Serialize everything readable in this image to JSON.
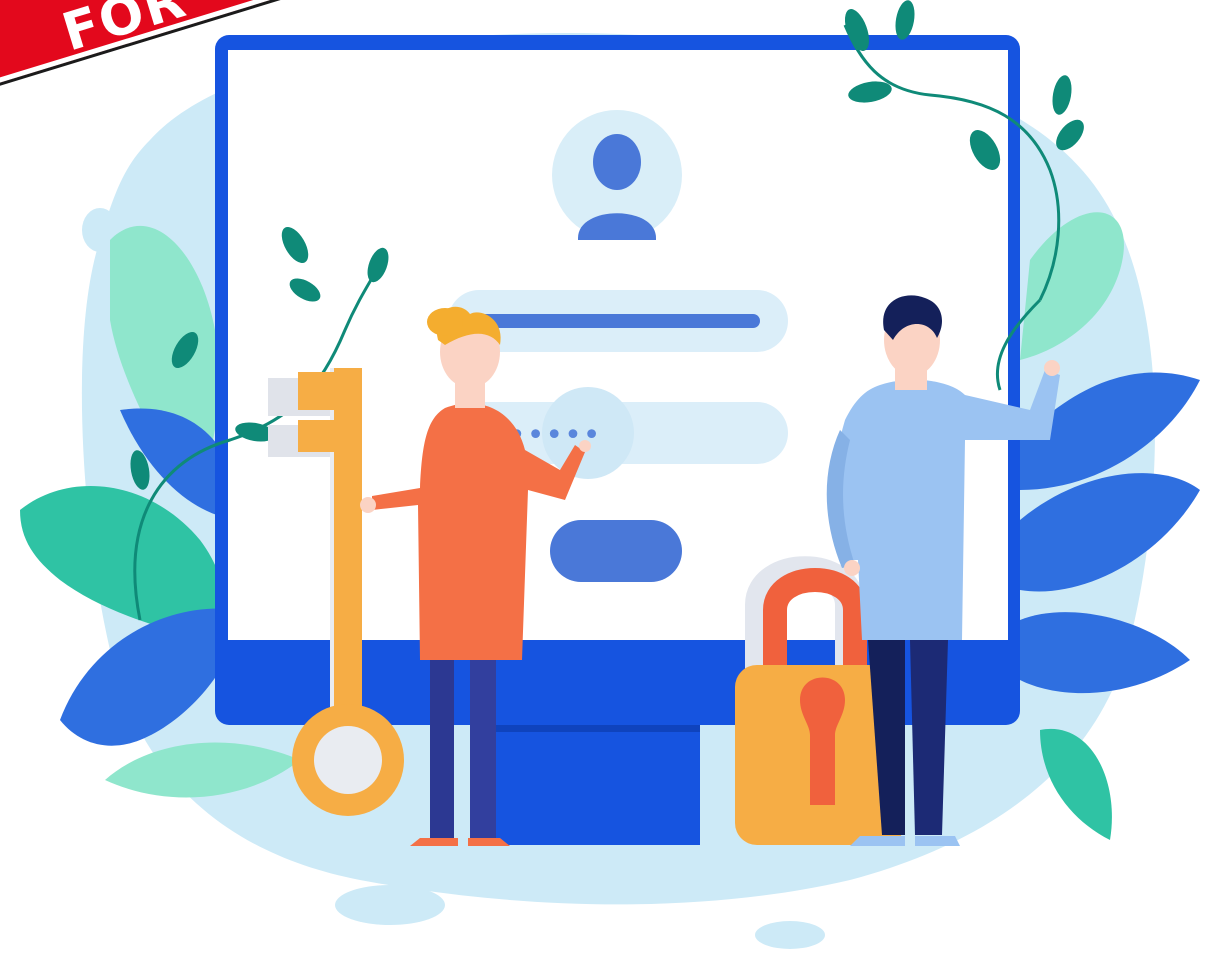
{
  "banner": {
    "text": "FOR"
  },
  "illustration": {
    "subject": "login-screen",
    "password_mask": "•••••"
  },
  "colors": {
    "backdrop": "#cdeaf7",
    "monitor_frame": "#1654e0",
    "screen": "#ffffff",
    "field": "#dbeef9",
    "field_line": "#4a78d8",
    "button": "#4a78d8",
    "avatar_bg": "#d9eef8",
    "avatar": "#4a78d8",
    "leaf_dark": "#0f8a78",
    "leaf_teal": "#2fc3a4",
    "leaf_mint": "#8fe6cc",
    "leaf_blue": "#2f6fe0",
    "key": "#f6ad45",
    "lock_body": "#f6ad45",
    "lock_shackle": "#f0613d",
    "keyhole": "#f0613d",
    "woman_top": "#f47046",
    "woman_hair": "#f4ad2f",
    "man_top": "#9bc3f2",
    "man_hair": "#14205a",
    "pants": "#2c3892",
    "skin": "#fbd3c4",
    "banner_red": "#e3081c"
  }
}
